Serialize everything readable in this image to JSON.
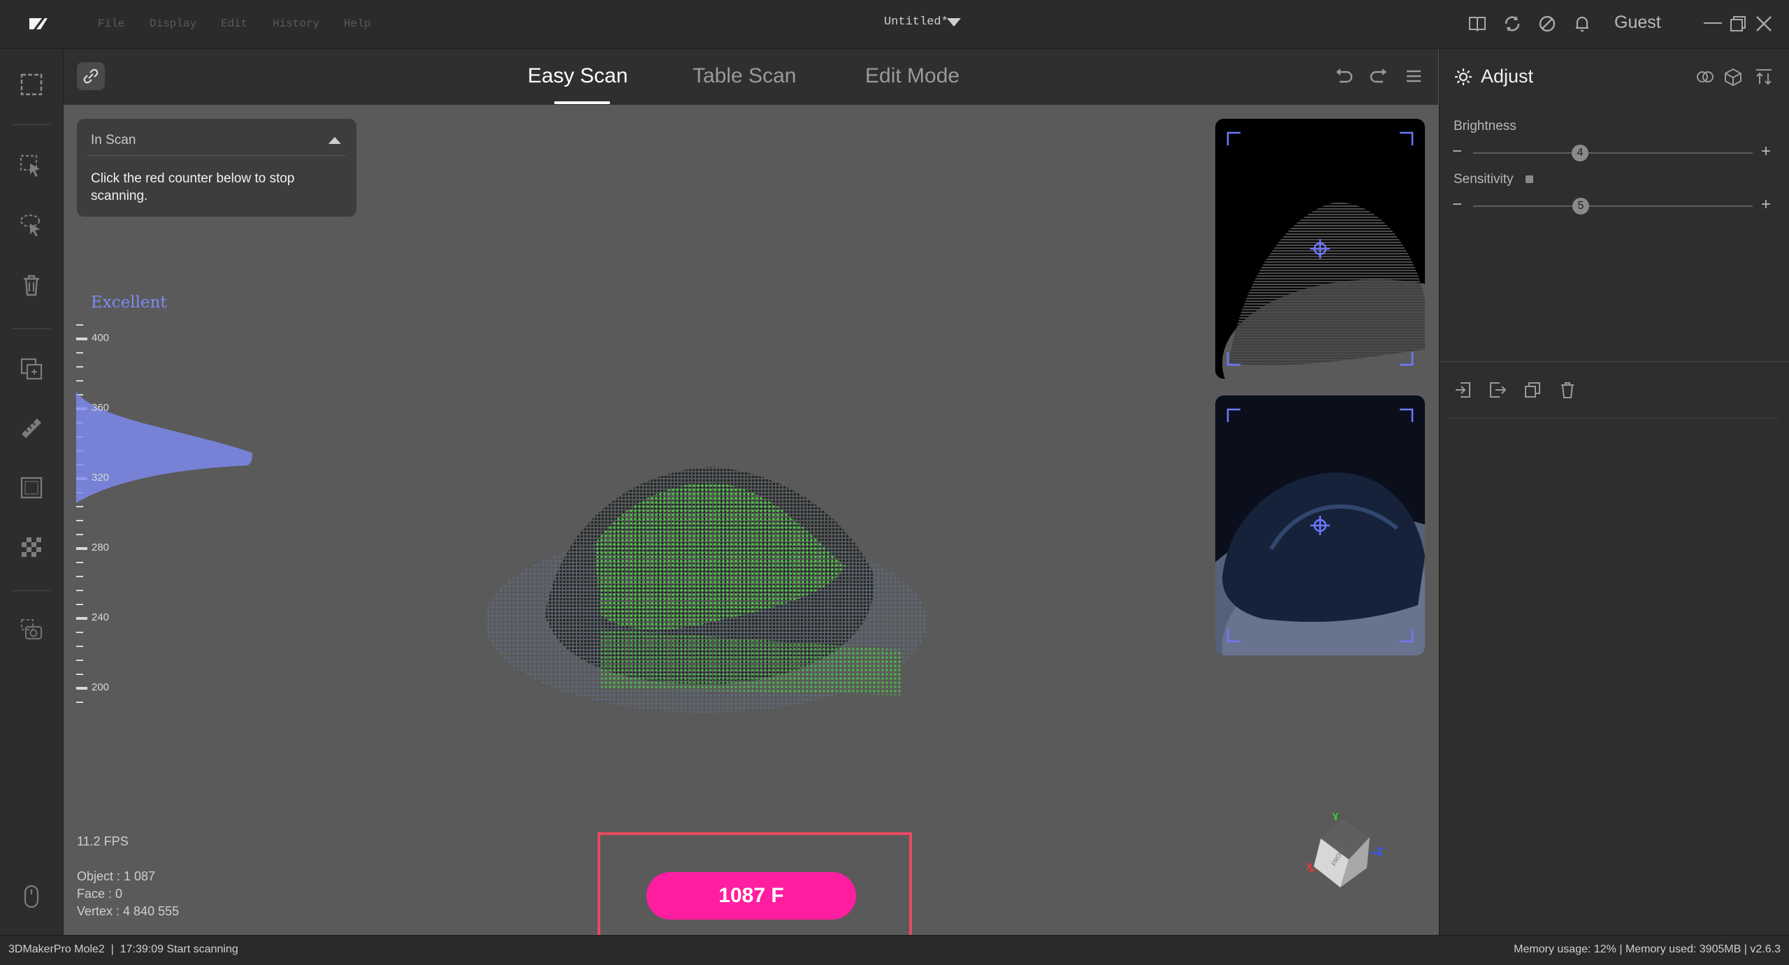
{
  "window": {
    "title": "Untitled*",
    "user": "Guest",
    "menu": [
      "File",
      "Display",
      "Edit",
      "History",
      "Help"
    ]
  },
  "modes": {
    "tabs": [
      "Easy Scan",
      "Table Scan",
      "Edit Mode"
    ],
    "active": "Easy Scan"
  },
  "scan_status": {
    "title": "In Scan",
    "message": "Click the red counter below to stop scanning."
  },
  "quality_gauge": {
    "label": "Excellent",
    "ticks": [
      "400",
      "360",
      "320",
      "280",
      "240",
      "200"
    ],
    "color": "#7e8cf5"
  },
  "stats": {
    "fps": "11.2 FPS",
    "object": "Object : 1 087",
    "face": "Face : 0",
    "vertex": "Vertex : 4 840 555"
  },
  "counter_button": {
    "label": "1087 F",
    "color": "#ff1ea0"
  },
  "adjust_panel": {
    "title": "Adjust",
    "brightness": {
      "label": "Brightness",
      "value": "4",
      "level": 0.36
    },
    "sensitivity": {
      "label": "Sensitivity",
      "value": "5",
      "level": 0.36
    }
  },
  "orientation_cube": {
    "face_label": "FRONT",
    "axes": [
      "Y",
      "Z",
      "X"
    ]
  },
  "status_bar": {
    "left": "3DMakerPro Mole2  |  17:39:09 Start scanning",
    "right": "Memory usage: 12% | Memory used: 3905MB | v2.6.3"
  },
  "icons": {
    "app": "app-logo-icon",
    "toolbar": [
      "book-icon",
      "sync-icon",
      "theme-icon",
      "bell-icon"
    ],
    "left": [
      "select-rect-icon",
      "select-pointer-icon",
      "lasso-icon",
      "trash-icon",
      "layers-icon",
      "ruler-icon",
      "frame-icon",
      "checker-icon",
      "camera-icon",
      "mouse-icon"
    ]
  }
}
